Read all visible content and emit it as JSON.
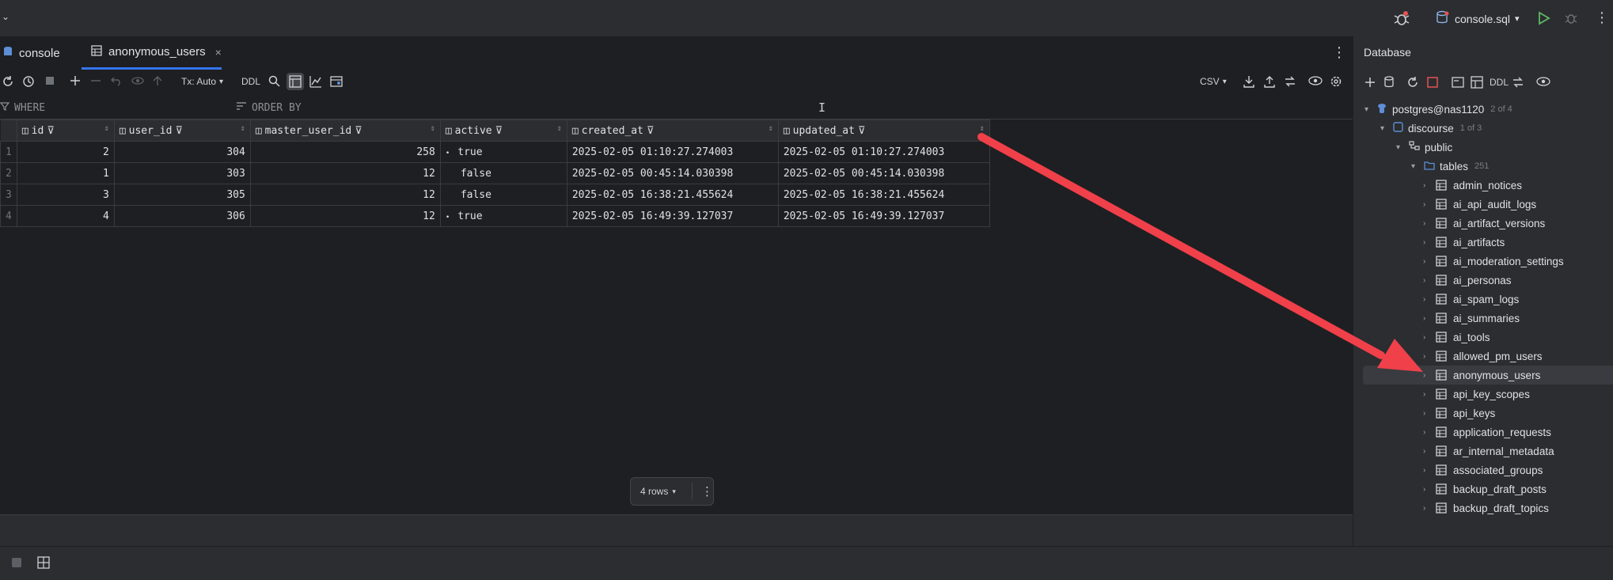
{
  "window": {
    "run_config": "console.sql"
  },
  "tabs": [
    {
      "label": "console"
    },
    {
      "label": "anonymous_users"
    }
  ],
  "toolbar": {
    "tx": "Tx: Auto",
    "ddl": "DDL",
    "export": "CSV"
  },
  "filter": {
    "where": "WHERE",
    "order_by": "ORDER BY"
  },
  "grid": {
    "columns": [
      "id",
      "user_id",
      "master_user_id",
      "active",
      "created_at",
      "updated_at"
    ],
    "rows": [
      {
        "n": "1",
        "id": "2",
        "user_id": "304",
        "master_user_id": "258",
        "active": "true",
        "created_at": "2025-02-05 01:10:27.274003",
        "updated_at": "2025-02-05 01:10:27.274003"
      },
      {
        "n": "2",
        "id": "1",
        "user_id": "303",
        "master_user_id": "12",
        "active": "false",
        "created_at": "2025-02-05 00:45:14.030398",
        "updated_at": "2025-02-05 00:45:14.030398"
      },
      {
        "n": "3",
        "id": "3",
        "user_id": "305",
        "master_user_id": "12",
        "active": "false",
        "created_at": "2025-02-05 16:38:21.455624",
        "updated_at": "2025-02-05 16:38:21.455624"
      },
      {
        "n": "4",
        "id": "4",
        "user_id": "306",
        "master_user_id": "12",
        "active": "true",
        "created_at": "2025-02-05 16:49:39.127037",
        "updated_at": "2025-02-05 16:49:39.127037"
      }
    ],
    "row_count": "4 rows"
  },
  "sidebar": {
    "title": "Database",
    "ddl": "DDL",
    "connection": {
      "label": "postgres@nas1120",
      "count": "2 of 4"
    },
    "database": {
      "label": "discourse",
      "count": "1 of 3"
    },
    "schema": {
      "label": "public"
    },
    "tables_folder": {
      "label": "tables",
      "count": "251"
    },
    "tables": [
      "admin_notices",
      "ai_api_audit_logs",
      "ai_artifact_versions",
      "ai_artifacts",
      "ai_moderation_settings",
      "ai_personas",
      "ai_spam_logs",
      "ai_summaries",
      "ai_tools",
      "allowed_pm_users",
      "anonymous_users",
      "api_key_scopes",
      "api_keys",
      "application_requests",
      "ar_internal_metadata",
      "associated_groups",
      "backup_draft_posts",
      "backup_draft_topics"
    ],
    "selected_table": "anonymous_users"
  },
  "colors": {
    "accent": "#3574f0",
    "arrow": "#f0404a",
    "run": "#5fb865"
  }
}
